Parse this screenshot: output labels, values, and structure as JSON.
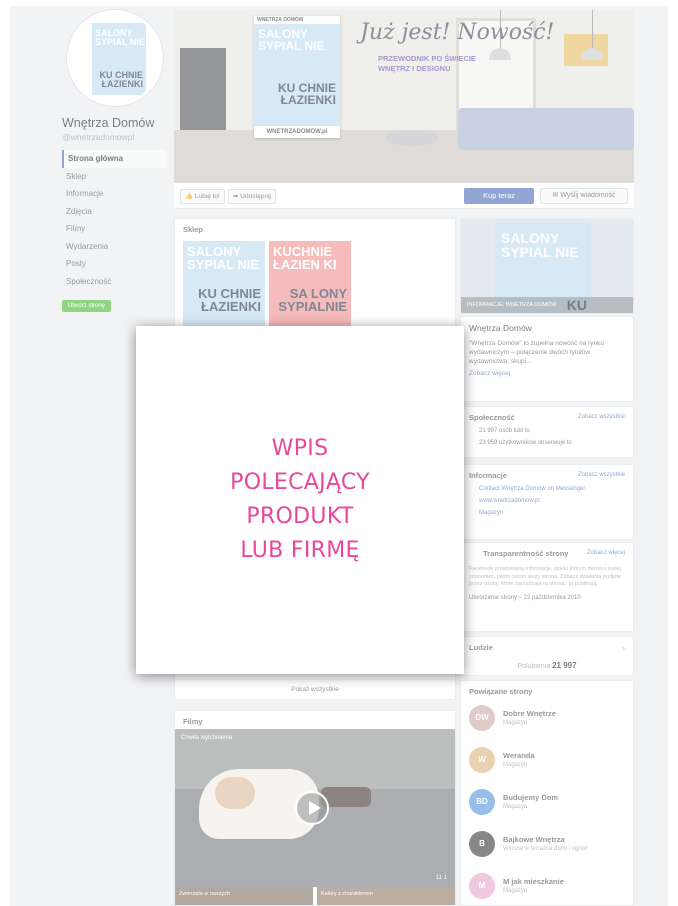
{
  "page": {
    "name": "Wnętrza Domów",
    "handle": "@wnetrzadomowpl"
  },
  "nav": {
    "items": [
      {
        "label": "Strona główna"
      },
      {
        "label": "Sklep"
      },
      {
        "label": "Informacje"
      },
      {
        "label": "Zdjęcia"
      },
      {
        "label": "Filmy"
      },
      {
        "label": "Wydarzenia"
      },
      {
        "label": "Posty"
      },
      {
        "label": "Społeczność"
      }
    ],
    "create_page": "Utwórz stronę"
  },
  "cover": {
    "magazine_top": "WNETRZA DOMÓW",
    "magazine_line1": "SALONY SYPIAL NIE",
    "magazine_line2": "KU CHNIE ŁAZIENKI",
    "magazine_url": "WNETRZADOMOW.pl",
    "headline": "Już jest! Nowość!",
    "subline1": "PRZEWODNIK PO ŚWIECIE",
    "subline2": "WNĘTRZ I DESIGNU"
  },
  "actions": {
    "like": "Lubię to!",
    "share": "Udostępnij",
    "shop_now": "Kup teraz",
    "send_message": "Wyślij wiadomość"
  },
  "shop": {
    "title": "Sklep",
    "product1_a": "SALONY SYPIAL NIE",
    "product1_b": "KU CHNIE ŁAZIENKI",
    "product2_a": "KUCHNIE ŁAZIEN KI",
    "product2_b": "SA LONY SYPIALNIE",
    "see_all": "Pokaż wszystkie"
  },
  "films": {
    "title": "Filmy",
    "video_label": "Chwila wytchnienia",
    "video_stats": "11   1",
    "thumb1": "Zwierzęta w naszych",
    "thumb2": "Kolory z charakterem"
  },
  "promo": {
    "caption": "INFORMACJE: WNETRZA DOMÓW",
    "mag_a": "SALONY SYPIAL NIE",
    "mag_b": "KU"
  },
  "about": {
    "title": "Wnętrza Domów",
    "text": "\"Wnętrza Domów\" to zupełna nowość na rynku wydawniczym – połączenie dwóch tytułów wydawnictwa, skupi...",
    "more": "Zobacz więcej"
  },
  "community": {
    "title": "Społeczność",
    "see_all": "Zobacz wszystkie",
    "likes": "21 997 osób lubi to",
    "follows": "23 959 użytkowników obserwuje to"
  },
  "info": {
    "title": "Informacje",
    "see_all": "Zobacz wszystkie",
    "messenger": "Contact Wnętrza Domów on Messenger",
    "website": "www.wnetrzadomow.pl",
    "category": "Magazyn"
  },
  "transparency": {
    "title": "Transparentność strony",
    "see_more": "Zobacz więcej",
    "text": "Facebook przedstawia informacje, dzięki którym możesz lepiej zrozumieć, jakim celom służy strona. Zobacz działania podjęte przez osoby, które zarządzają tą stroną i ją publikują.",
    "created": "Utworzenie strony – 22 października 2010"
  },
  "people": {
    "title": "Ludzie",
    "likes_label": "Polubienia",
    "likes_value": "21 997"
  },
  "related": {
    "title": "Powiązane strony",
    "items": [
      {
        "name": "Dobre Wnętrze",
        "sub": "Magazyn",
        "initials": "DW",
        "color": "#c9a7a0"
      },
      {
        "name": "Weranda",
        "sub": "Magazyn",
        "initials": "W",
        "color": "#d8b27a"
      },
      {
        "name": "Budujemy Dom",
        "sub": "Magazyn",
        "initials": "BD",
        "color": "#4a90d9"
      },
      {
        "name": "Bajkowe Wnętrza",
        "sub": "Wiosna w ferrażce domi i ogród",
        "initials": "B",
        "color": "#2f3133"
      },
      {
        "name": "M jak mieszkanie",
        "sub": "Magazyn",
        "initials": "M",
        "color": "#e6a0c8"
      }
    ]
  },
  "overlay": {
    "line1": "WPIS",
    "line2": "POLECAJĄCY",
    "line3": "PRODUKT",
    "line4": "LUB FIRMĘ"
  },
  "colors": {
    "overlay_text": "#e8479a",
    "fb_blue": "#4267b2",
    "page_bg": "#e9ebee"
  }
}
